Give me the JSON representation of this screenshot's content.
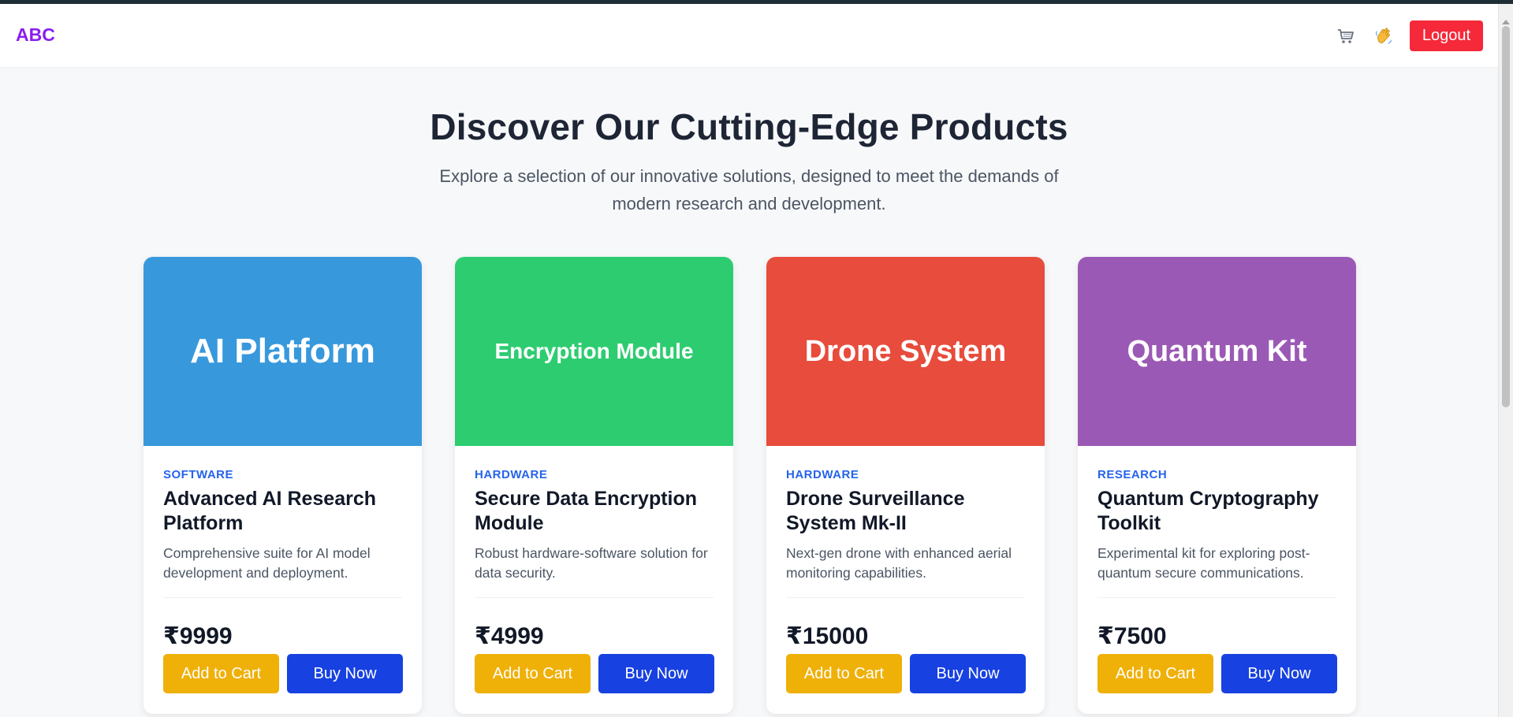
{
  "nav": {
    "brand": "ABC",
    "cart_icon": "cart-icon",
    "wave_icon": "waving-hand-icon",
    "logout_label": "Logout",
    "logout_color": "#f5293a",
    "brand_color": "#8a1df0"
  },
  "hero": {
    "title": "Discover Our Cutting-Edge Products",
    "subtitle": "Explore a selection of our innovative solutions, designed to meet the demands of modern research and development."
  },
  "products": [
    {
      "banner": "AI Platform",
      "banner_color": "#3898dc",
      "category": "SOFTWARE",
      "name": "Advanced AI Research Platform",
      "description": "Comprehensive suite for AI model development and deployment.",
      "price": "₹9999",
      "cart_label": "Add to Cart",
      "buy_label": "Buy Now"
    },
    {
      "banner": "Encryption Module",
      "banner_color": "#2ecc71",
      "category": "HARDWARE",
      "name": "Secure Data Encryption Module",
      "description": "Robust hardware-software solution for data security.",
      "price": "₹4999",
      "cart_label": "Add to Cart",
      "buy_label": "Buy Now"
    },
    {
      "banner": "Drone System",
      "banner_color": "#e74c3c",
      "category": "HARDWARE",
      "name": "Drone Surveillance System Mk-II",
      "description": "Next-gen drone with enhanced aerial monitoring capabilities.",
      "price": "₹15000",
      "cart_label": "Add to Cart",
      "buy_label": "Buy Now"
    },
    {
      "banner": "Quantum Kit",
      "banner_color": "#9b59b6",
      "category": "RESEARCH",
      "name": "Quantum Cryptography Toolkit",
      "description": "Experimental kit for exploring post-quantum secure communications.",
      "price": "₹7500",
      "cart_label": "Add to Cart",
      "buy_label": "Buy Now"
    }
  ]
}
